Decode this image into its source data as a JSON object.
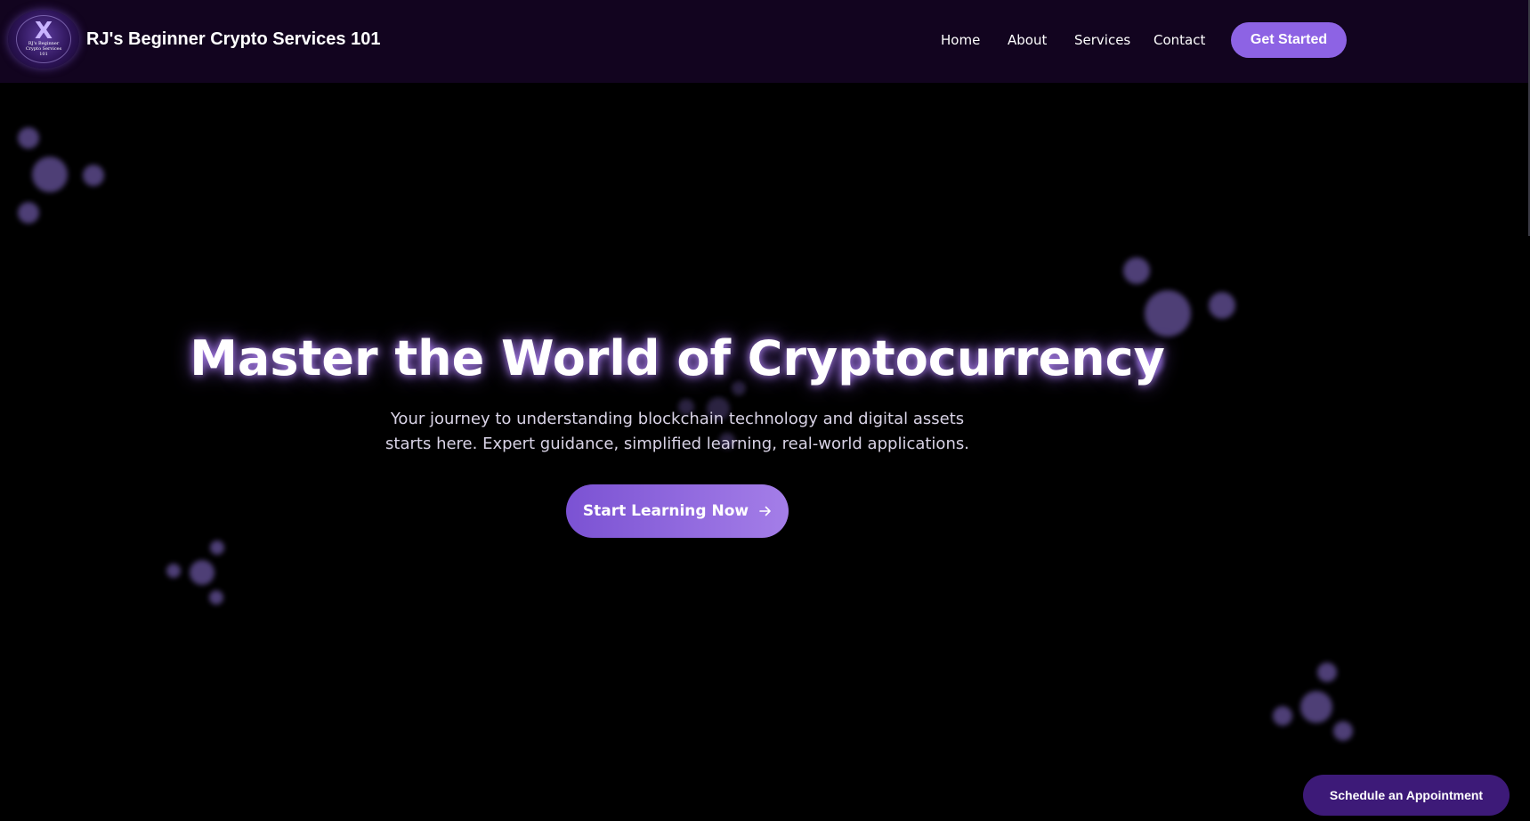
{
  "header": {
    "logo": {
      "icon": "x-coin-logo",
      "caption": "RJ's Beginner Crypto Services 101"
    },
    "brand_name": "RJ's Beginner Crypto Services 101",
    "nav": {
      "home": "Home",
      "about": "About",
      "services": "Services",
      "contact": "Contact"
    },
    "cta_label": "Get Started"
  },
  "hero": {
    "title": "Master the World of Cryptocurrency",
    "subtitle": "Your journey to understanding blockchain technology and digital assets starts here. Expert guidance, simplified learning, real-world applications.",
    "cta_label": "Start Learning Now",
    "cta_icon": "arrow-right-icon"
  },
  "floating_button": {
    "label": "Schedule an Appointment"
  },
  "colors": {
    "background": "#000000",
    "header_background": "#12041f",
    "accent": "#8d63e4",
    "floating_button": "#3d1a78",
    "particle": "#8e73d8"
  }
}
